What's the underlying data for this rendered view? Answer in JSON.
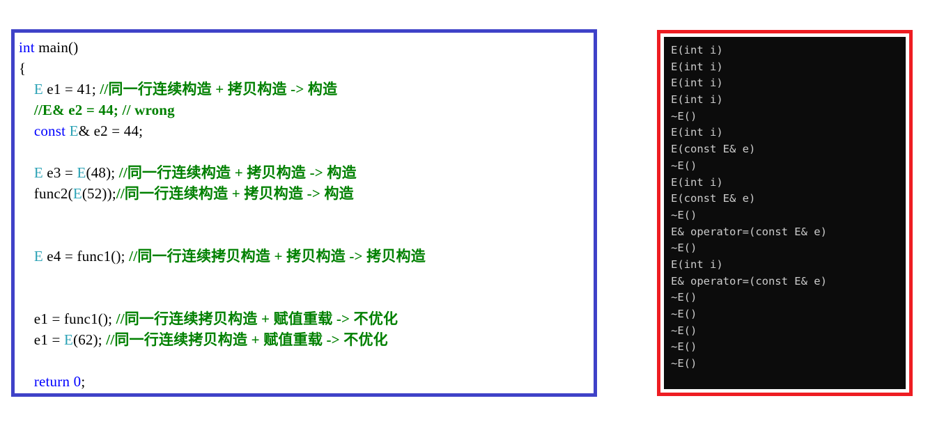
{
  "colors": {
    "code_border": "#3f42c8",
    "console_border": "#ee1d22",
    "console_background": "#0c0c0c",
    "console_text": "#cccccc",
    "keyword": "#0000ff",
    "type_name": "#2ba2b5",
    "comment": "#008000",
    "page_background": "#ffffff"
  },
  "code_panel": {
    "language": "cpp",
    "lines": [
      {
        "segments": [
          {
            "t": "int",
            "c": "kw"
          },
          {
            "t": " main()",
            "c": "plain"
          }
        ]
      },
      {
        "segments": [
          {
            "t": "{",
            "c": "plain"
          }
        ]
      },
      {
        "segments": [
          {
            "t": "    ",
            "c": "plain"
          },
          {
            "t": "E",
            "c": "type"
          },
          {
            "t": " e1 = 41; ",
            "c": "plain"
          },
          {
            "t": "//同一行连续构造 + 拷贝构造 -> 构造",
            "c": "cmt"
          }
        ]
      },
      {
        "segments": [
          {
            "t": "    ",
            "c": "plain"
          },
          {
            "t": "//E& e2 = 44; // wrong",
            "c": "cmt"
          }
        ]
      },
      {
        "segments": [
          {
            "t": "    ",
            "c": "plain"
          },
          {
            "t": "const",
            "c": "kw"
          },
          {
            "t": " ",
            "c": "plain"
          },
          {
            "t": "E",
            "c": "type"
          },
          {
            "t": "& e2 = 44;",
            "c": "plain"
          }
        ]
      },
      {
        "segments": []
      },
      {
        "segments": [
          {
            "t": "    ",
            "c": "plain"
          },
          {
            "t": "E",
            "c": "type"
          },
          {
            "t": " e3 = ",
            "c": "plain"
          },
          {
            "t": "E",
            "c": "type"
          },
          {
            "t": "(48); ",
            "c": "plain"
          },
          {
            "t": "//同一行连续构造 + 拷贝构造 -> 构造",
            "c": "cmt"
          }
        ]
      },
      {
        "segments": [
          {
            "t": "    func2(",
            "c": "plain"
          },
          {
            "t": "E",
            "c": "type"
          },
          {
            "t": "(52));",
            "c": "plain"
          },
          {
            "t": "//同一行连续构造 + 拷贝构造 -> 构造",
            "c": "cmt"
          }
        ]
      },
      {
        "segments": []
      },
      {
        "segments": []
      },
      {
        "segments": [
          {
            "t": "    ",
            "c": "plain"
          },
          {
            "t": "E",
            "c": "type"
          },
          {
            "t": " e4 = func1(); ",
            "c": "plain"
          },
          {
            "t": "//同一行连续拷贝构造 + 拷贝构造 -> 拷贝构造",
            "c": "cmt"
          }
        ]
      },
      {
        "segments": []
      },
      {
        "segments": []
      },
      {
        "segments": [
          {
            "t": "    e1 = func1(); ",
            "c": "plain"
          },
          {
            "t": "//同一行连续拷贝构造 + 赋值重载 -> 不优化",
            "c": "cmt"
          }
        ]
      },
      {
        "segments": [
          {
            "t": "    e1 = ",
            "c": "plain"
          },
          {
            "t": "E",
            "c": "type"
          },
          {
            "t": "(62); ",
            "c": "plain"
          },
          {
            "t": "//同一行连续拷贝构造 + 赋值重载 -> 不优化",
            "c": "cmt"
          }
        ]
      },
      {
        "segments": []
      },
      {
        "segments": [
          {
            "t": "    ",
            "c": "plain"
          },
          {
            "t": "return",
            "c": "kw"
          },
          {
            "t": " ",
            "c": "plain"
          },
          {
            "t": "0",
            "c": "kw"
          },
          {
            "t": ";",
            "c": "plain"
          }
        ]
      },
      {
        "segments": [
          {
            "t": "}",
            "c": "plain"
          }
        ]
      }
    ]
  },
  "console_panel": {
    "lines": [
      "E(int i)",
      "E(int i)",
      "E(int i)",
      "E(int i)",
      "~E()",
      "E(int i)",
      "E(const E& e)",
      "~E()",
      "E(int i)",
      "E(const E& e)",
      "~E()",
      "E& operator=(const E& e)",
      "~E()",
      "E(int i)",
      "E& operator=(const E& e)",
      "~E()",
      "~E()",
      "~E()",
      "~E()",
      "~E()"
    ]
  }
}
